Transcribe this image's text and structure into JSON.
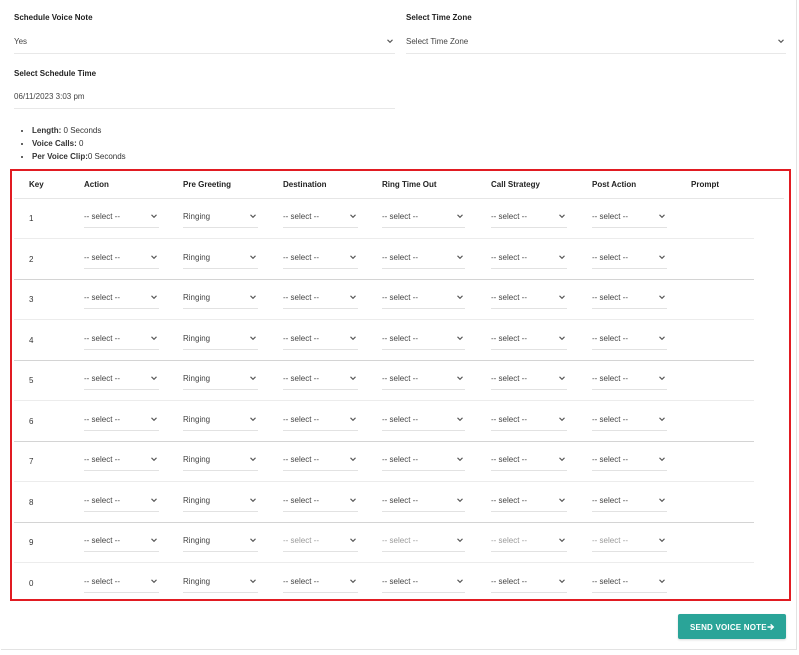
{
  "schedule": {
    "voice_note_label": "Schedule Voice Note",
    "voice_note_value": "Yes",
    "timezone_label": "Select Time Zone",
    "timezone_value": "Select Time Zone",
    "time_label": "Select Schedule Time",
    "time_value": "06/11/2023 3:03 pm"
  },
  "stats": [
    {
      "label": "Length:",
      "value": " 0 Seconds"
    },
    {
      "label": "Voice Calls:",
      "value": " 0"
    },
    {
      "label": "Per Voice Clip:",
      "value": "0 Seconds"
    }
  ],
  "table": {
    "headers": [
      "Key",
      "Action",
      "Pre Greeting",
      "Destination",
      "Ring Time Out",
      "Call Strategy",
      "Post Action",
      "Prompt"
    ],
    "rows": [
      {
        "key": "1",
        "action": "-- select --",
        "pre_greeting": "Ringing",
        "destination": "-- select --",
        "ring_time_out": "-- select --",
        "call_strategy": "-- select --",
        "post_action": "-- select --"
      },
      {
        "key": "2",
        "action": "-- select --",
        "pre_greeting": "Ringing",
        "destination": "-- select --",
        "ring_time_out": "-- select --",
        "call_strategy": "-- select --",
        "post_action": "-- select --"
      },
      {
        "key": "3",
        "action": "-- select --",
        "pre_greeting": "Ringing",
        "destination": "-- select --",
        "ring_time_out": "-- select --",
        "call_strategy": "-- select --",
        "post_action": "-- select --"
      },
      {
        "key": "4",
        "action": "-- select --",
        "pre_greeting": "Ringing",
        "destination": "-- select --",
        "ring_time_out": "-- select --",
        "call_strategy": "-- select --",
        "post_action": "-- select --"
      },
      {
        "key": "5",
        "action": "-- select --",
        "pre_greeting": "Ringing",
        "destination": "-- select --",
        "ring_time_out": "-- select --",
        "call_strategy": "-- select --",
        "post_action": "-- select --"
      },
      {
        "key": "6",
        "action": "-- select --",
        "pre_greeting": "Ringing",
        "destination": "-- select --",
        "ring_time_out": "-- select --",
        "call_strategy": "-- select --",
        "post_action": "-- select --"
      },
      {
        "key": "7",
        "action": "-- select --",
        "pre_greeting": "Ringing",
        "destination": "-- select --",
        "ring_time_out": "-- select --",
        "call_strategy": "-- select --",
        "post_action": "-- select --"
      },
      {
        "key": "8",
        "action": "-- select --",
        "pre_greeting": "Ringing",
        "destination": "-- select --",
        "ring_time_out": "-- select --",
        "call_strategy": "-- select --",
        "post_action": "-- select --"
      },
      {
        "key": "9",
        "action": "-- select --",
        "pre_greeting": "Ringing",
        "destination": "-- select --",
        "ring_time_out": "-- select --",
        "call_strategy": "-- select --",
        "post_action": "-- select --"
      },
      {
        "key": "0",
        "action": "-- select --",
        "pre_greeting": "Ringing",
        "destination": "-- select --",
        "ring_time_out": "-- select --",
        "call_strategy": "-- select --",
        "post_action": "-- select --"
      }
    ]
  },
  "actions": {
    "send_label": "SEND VOICE NOTE",
    "send_icon": "arrow-right-icon"
  },
  "colors": {
    "highlight_border": "#e11b22",
    "button_bg": "#2aa498"
  }
}
